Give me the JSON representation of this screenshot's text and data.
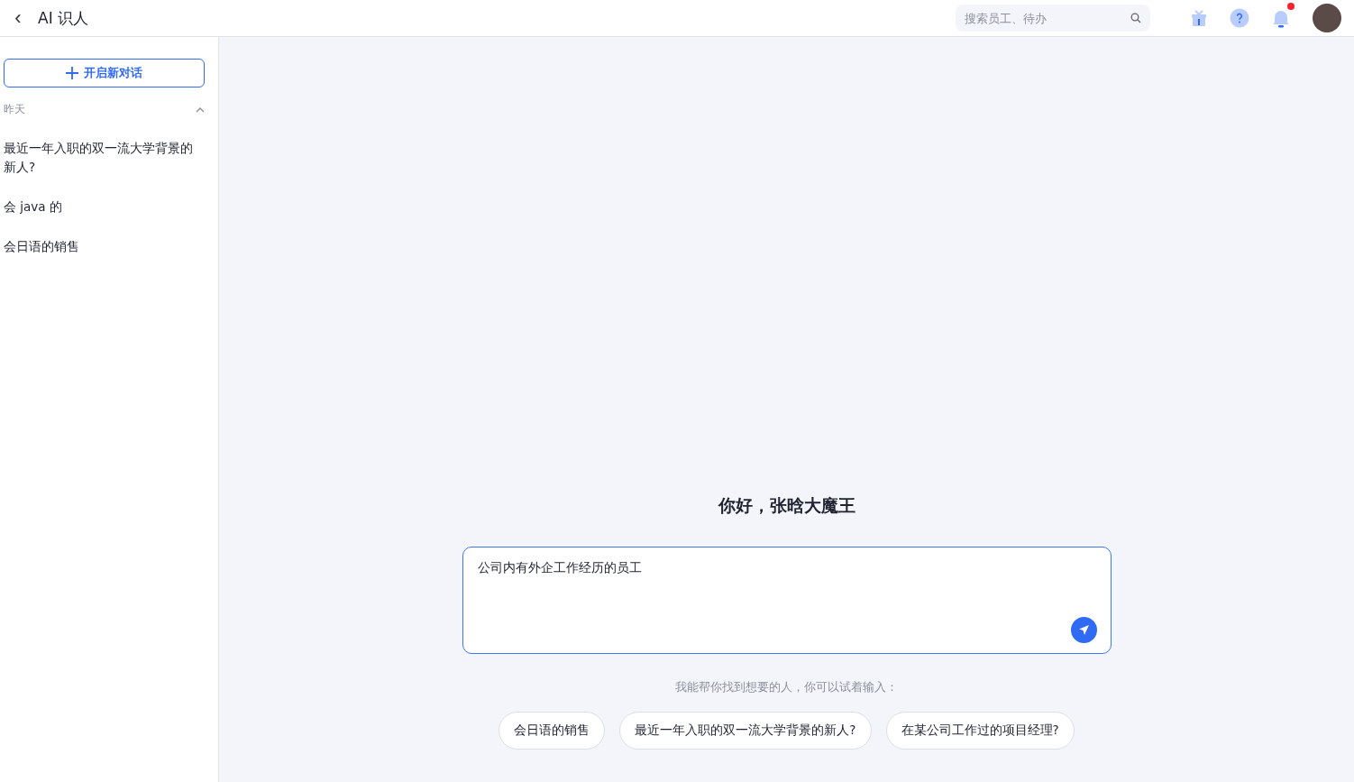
{
  "header": {
    "back_icon": "‹",
    "title": "AI 识人",
    "search": {
      "placeholder": "搜索员工、待办"
    },
    "notification_dot": true
  },
  "sidebar": {
    "new_chat_button": "开启新对话",
    "groups": [
      {
        "label": "昨天",
        "expanded": true,
        "items": [
          {
            "label": "最近一年入职的双一流大学背景的新人?",
            "selected": false
          },
          {
            "label": "会 java 的",
            "selected": false
          },
          {
            "label": "会日语的销售",
            "selected": false
          }
        ]
      }
    ]
  },
  "main": {
    "greeting": "你好，张晗大魔王",
    "input": {
      "value": "公司内有外企工作经历的员工"
    },
    "hint": "我能帮你找到想要的人，你可以试着输入：",
    "suggestions": [
      "会日语的销售",
      "最近一年入职的双一流大学背景的新人?",
      "在某公司工作过的项目经理?"
    ]
  }
}
